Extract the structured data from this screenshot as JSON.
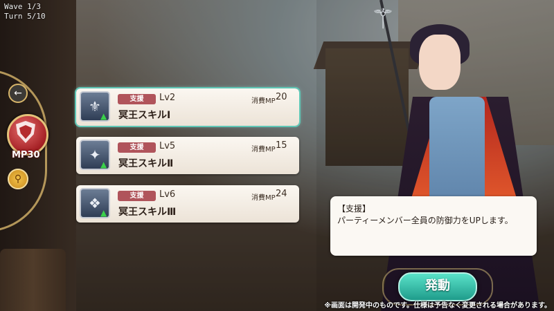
{
  "hud": {
    "wave": "Wave  1/3",
    "turn": "Turn   5/10"
  },
  "left_menu": {
    "back_icon": "arrow-left-icon",
    "skill_mp": "MP30",
    "search_icon": "magnifier-icon"
  },
  "skills": [
    {
      "tag": "支援",
      "level": "Lv2",
      "cost_label": "消費MP",
      "cost": "20",
      "name": "冥王スキルⅠ",
      "selected": true
    },
    {
      "tag": "支援",
      "level": "Lv5",
      "cost_label": "消費MP",
      "cost": "15",
      "name": "冥王スキルⅡ",
      "selected": false
    },
    {
      "tag": "支援",
      "level": "Lv6",
      "cost_label": "消費MP",
      "cost": "24",
      "name": "冥王スキルⅢ",
      "selected": false
    }
  ],
  "description": {
    "title": "【支援】",
    "text": "パーティーメンバー全員の防御力をUPします。"
  },
  "activate_label": "発動",
  "notice": "※画面は開発中のものです。仕様は予告なく変更される場合があります。",
  "colors": {
    "tag": "#b0545b",
    "activate": "#1f9c8b",
    "selected_outline": "#5fc7b6",
    "mp_badge": "#a52125"
  }
}
